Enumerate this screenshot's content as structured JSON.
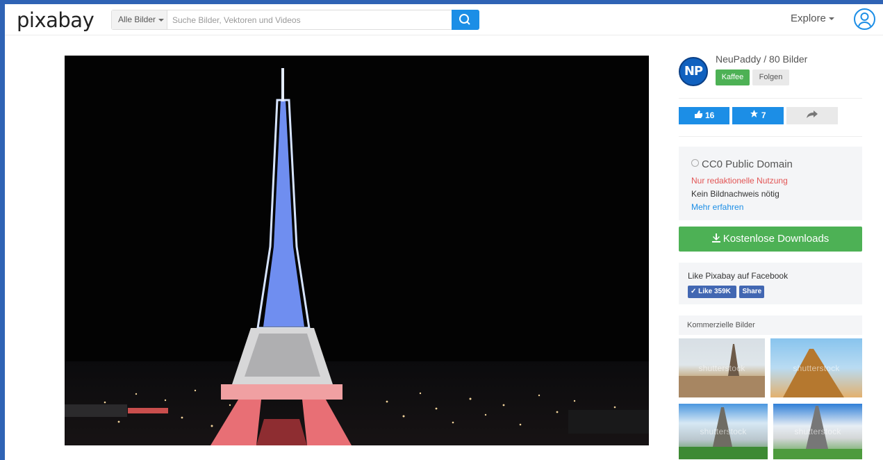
{
  "header": {
    "logo": "pixabay",
    "filter_label": "Alle Bilder",
    "search_placeholder": "Suche Bilder, Vektoren und Videos",
    "explore_label": "Explore"
  },
  "user": {
    "initials": "NP",
    "name_line": "NeuPaddy / 80 Bilder",
    "kaffee_label": "Kaffee",
    "follow_label": "Folgen"
  },
  "actions": {
    "like_count": "16",
    "favorite_count": "7"
  },
  "license": {
    "title": "CC0 Public Domain",
    "editorial": "Nur redaktionelle Nutzung",
    "attribution": "Kein Bildnachweis nötig",
    "learn_more": "Mehr erfahren"
  },
  "download_label": "Kostenlose Downloads",
  "facebook": {
    "title": "Like Pixabay auf Facebook",
    "like_label": "Like 359K",
    "share_label": "Share"
  },
  "commercial": {
    "heading": "Kommerzielle Bilder",
    "watermark": "shutterstock"
  },
  "colors": {
    "brand_blue": "#1c8ee6",
    "download_green": "#4db155",
    "editorial_red": "#e25555",
    "desktop_blue": "#2f63b5"
  }
}
